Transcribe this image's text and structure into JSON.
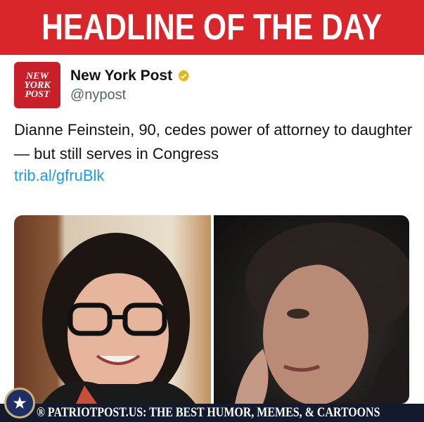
{
  "banner": {
    "title": "HEADLINE OF THE DAY"
  },
  "tweet": {
    "logo_lines": [
      "NEW",
      "YORK",
      "POST"
    ],
    "account_name": "New York Post",
    "handle": "@nypost",
    "text": "Dianne Feinstein, 90, cedes power of attorney to daughter — but still serves in Congress",
    "link": "trib.al/gfruBlk"
  },
  "footer": {
    "text": "® PATRIOTPOST.US: THE BEST HUMOR, MEMES, & CARTOONS",
    "seal_icon": "★"
  },
  "colors": {
    "banner": "#d8262b",
    "link": "#1d9bf0",
    "verified": "#e2b719",
    "footer_bg": "#131a2e"
  }
}
